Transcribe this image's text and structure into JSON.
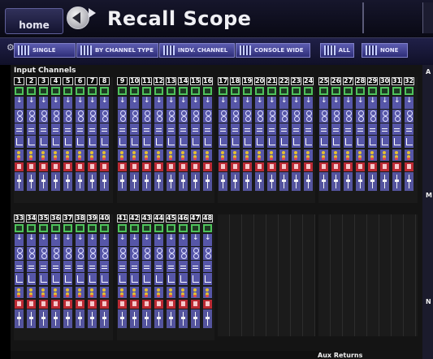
{
  "app": {
    "home_label": "home",
    "title": "Recall Scope"
  },
  "toolbar": {
    "buttons": [
      {
        "label": "SINGLE",
        "icon": "single-channel-icon"
      },
      {
        "label": "BY CHANNEL TYPE",
        "icon": "channel-type-icon"
      },
      {
        "label": "INDV. CHANNEL",
        "icon": "individual-channel-icon"
      },
      {
        "label": "CONSOLE WIDE",
        "icon": "console-wide-icon"
      },
      {
        "label": "ALL",
        "icon": "select-all-icon"
      },
      {
        "label": "NONE",
        "icon": "select-none-icon"
      }
    ]
  },
  "input_channels": {
    "label": "Input Channels",
    "group1": [
      "1",
      "2",
      "3",
      "4",
      "5",
      "6",
      "7",
      "8"
    ],
    "group2": [
      "9",
      "10",
      "11",
      "12",
      "13",
      "14",
      "15",
      "16"
    ],
    "group3": [
      "17",
      "18",
      "19",
      "20",
      "21",
      "22",
      "23",
      "24"
    ],
    "group4": [
      "25",
      "26",
      "27",
      "28",
      "29",
      "30",
      "31",
      "32"
    ],
    "group5": [
      "33",
      "34",
      "35",
      "36",
      "37",
      "38",
      "39",
      "40"
    ],
    "group6": [
      "41",
      "42",
      "43",
      "44",
      "45",
      "46",
      "47",
      "48"
    ]
  },
  "right_rail": {
    "letter_a": "A",
    "letter_m1": "M",
    "letter_m2": "N"
  },
  "bottom": {
    "aux_label": "Aux Returns"
  },
  "colors": {
    "block": "#5656a8",
    "selected": "#4ec25b",
    "mute": "#bb2a34"
  }
}
